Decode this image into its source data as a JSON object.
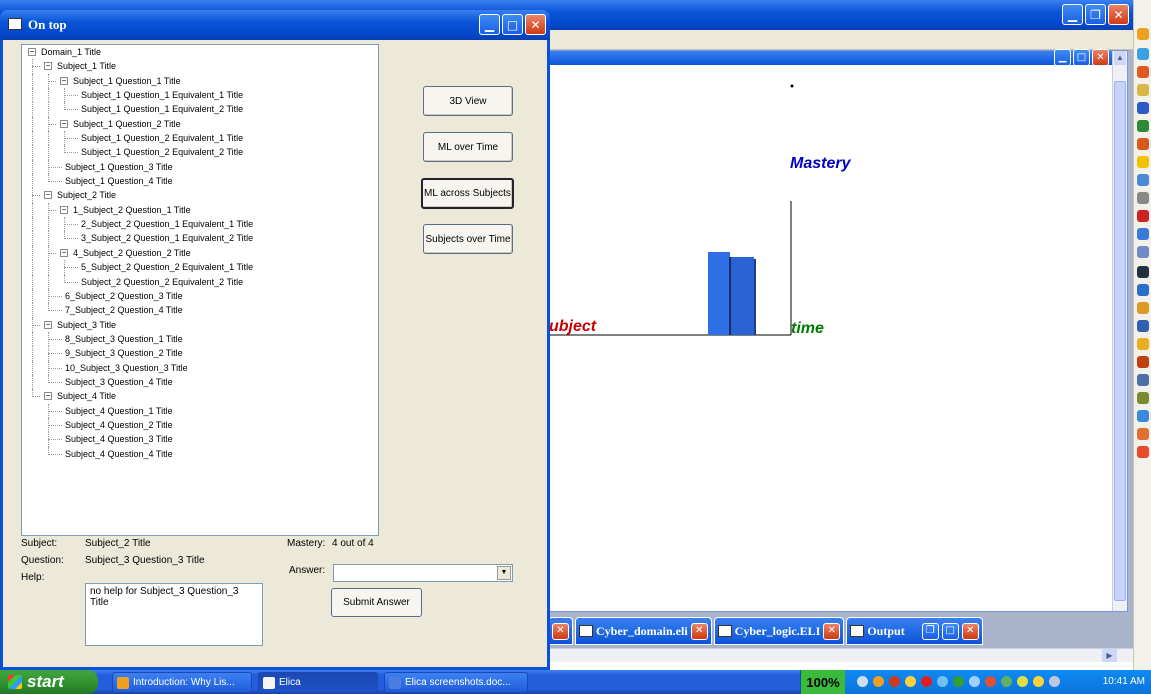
{
  "dialog": {
    "title": "On top",
    "tree": [
      {
        "depth": 0,
        "label": "Domain_1 Title",
        "expanded": true
      },
      {
        "depth": 1,
        "label": "Subject_1 Title",
        "expanded": true
      },
      {
        "depth": 2,
        "label": "Subject_1 Question_1 Title",
        "expanded": true
      },
      {
        "depth": 3,
        "label": "Subject_1 Question_1 Equivalent_1 Title"
      },
      {
        "depth": 3,
        "label": "Subject_1 Question_1 Equivalent_2 Title"
      },
      {
        "depth": 2,
        "label": "Subject_1 Question_2 Title",
        "expanded": true
      },
      {
        "depth": 3,
        "label": "Subject_1 Question_2 Equivalent_1 Title"
      },
      {
        "depth": 3,
        "label": "Subject_1 Question_2 Equivalent_2 Title"
      },
      {
        "depth": 2,
        "label": "Subject_1 Question_3 Title"
      },
      {
        "depth": 2,
        "label": "Subject_1 Question_4 Title"
      },
      {
        "depth": 1,
        "label": "Subject_2 Title",
        "expanded": true
      },
      {
        "depth": 2,
        "label": "1_Subject_2 Question_1 Title",
        "expanded": true
      },
      {
        "depth": 3,
        "label": "2_Subject_2 Question_1 Equivalent_1 Title"
      },
      {
        "depth": 3,
        "label": "3_Subject_2 Question_1 Equivalent_2 Title"
      },
      {
        "depth": 2,
        "label": "4_Subject_2 Question_2 Title",
        "expanded": true
      },
      {
        "depth": 3,
        "label": "5_Subject_2 Question_2 Equivalent_1 Title"
      },
      {
        "depth": 3,
        "label": "Subject_2 Question_2 Equivalent_2 Title"
      },
      {
        "depth": 2,
        "label": "6_Subject_2 Question_3 Title"
      },
      {
        "depth": 2,
        "label": "7_Subject_2 Question_4 Title"
      },
      {
        "depth": 1,
        "label": "Subject_3 Title",
        "expanded": true
      },
      {
        "depth": 2,
        "label": "8_Subject_3 Question_1 Title"
      },
      {
        "depth": 2,
        "label": "9_Subject_3 Question_2 Title"
      },
      {
        "depth": 2,
        "label": "10_Subject_3 Question_3 Title"
      },
      {
        "depth": 2,
        "label": "Subject_3 Question_4 Title"
      },
      {
        "depth": 1,
        "label": "Subject_4 Title",
        "expanded": true
      },
      {
        "depth": 2,
        "label": "Subject_4 Question_1 Title"
      },
      {
        "depth": 2,
        "label": "Subject_4 Question_2 Title"
      },
      {
        "depth": 2,
        "label": "Subject_4 Question_3 Title"
      },
      {
        "depth": 2,
        "label": "Subject_4 Question_4 Title"
      }
    ],
    "buttons": {
      "view_3d": "3D View",
      "ml_over_time": "ML over Time",
      "ml_across_subjects": "ML across Subjects",
      "subjects_over_time": "Subjects over Time",
      "submit": "Submit Answer"
    },
    "form": {
      "subject_label": "Subject:",
      "subject_value": "Subject_2 Title",
      "question_label": "Question:",
      "question_value": "Subject_3 Question_3 Title",
      "help_label": "Help:",
      "help_value": "no help for Subject_3 Question_3 Title",
      "mastery_label": "Mastery:",
      "mastery_value": "4 out of 4",
      "answer_label": "Answer:",
      "answer_value": ""
    }
  },
  "scene": {
    "label_mastery": "Mastery",
    "label_subject": "ubject",
    "label_time": "time",
    "colors": {
      "mastery": "#0000c8",
      "subject": "#c80000",
      "time": "#007a00",
      "bar": "#2f6fe8"
    }
  },
  "mdi_tabs": [
    {
      "label": ""
    },
    {
      "label": "Cyber_domain.eli"
    },
    {
      "label": "Cyber_logic.ELI"
    },
    {
      "label": "Output"
    }
  ],
  "taskbar": {
    "start": "start",
    "tasks": [
      "Introduction: Why Lis...",
      "Elica",
      "Elica screenshots.doc..."
    ],
    "zoom": "100%",
    "clock": "10:41 AM"
  }
}
